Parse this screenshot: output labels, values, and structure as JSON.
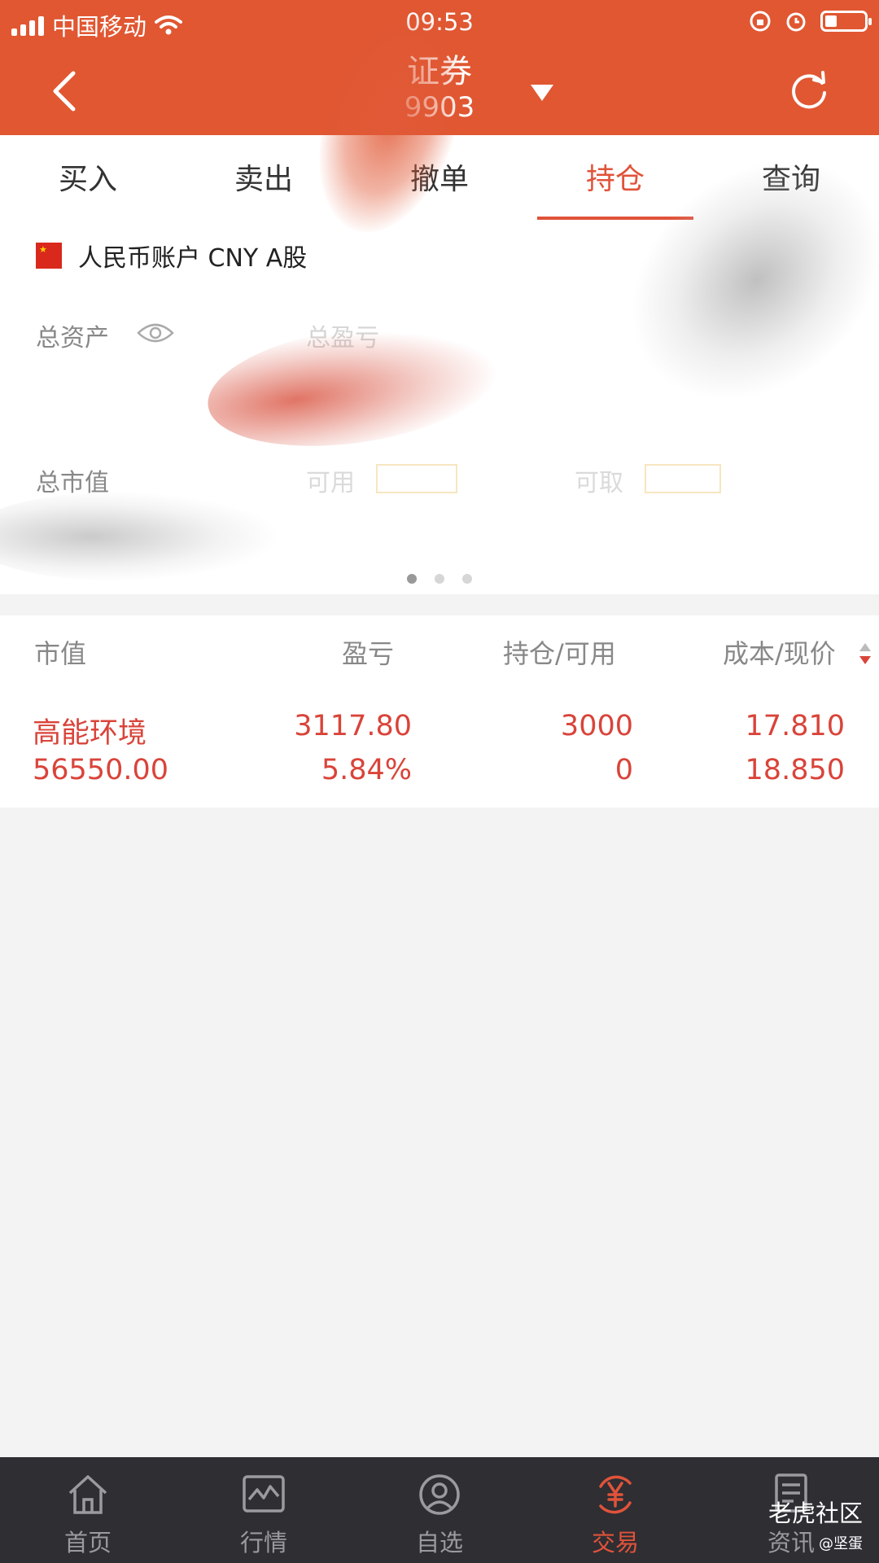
{
  "status_bar": {
    "carrier": "中国移动",
    "time": "09:53"
  },
  "nav": {
    "title": "证券",
    "subtitle": "9903"
  },
  "tabs": [
    {
      "label": "买入"
    },
    {
      "label": "卖出"
    },
    {
      "label": "撤单"
    },
    {
      "label": "持仓",
      "active": true
    },
    {
      "label": "查询"
    }
  ],
  "account": {
    "title": "人民币账户 CNY A股",
    "total_assets_label": "总资产",
    "total_pnl_label": "总盈亏",
    "market_value_label": "总市值",
    "available_label": "可用",
    "withdrawable_label": "可取"
  },
  "holdings": {
    "headers": {
      "market_value": "市值",
      "pnl": "盈亏",
      "position": "持仓/可用",
      "cost_price": "成本/现价"
    },
    "rows": [
      {
        "name": "高能环境",
        "market_value": "56550.00",
        "pnl": "3117.80",
        "pnl_pct": "5.84%",
        "position": "3000",
        "available": "0",
        "cost": "17.810",
        "price": "18.850"
      }
    ]
  },
  "bottom_nav": [
    {
      "label": "首页",
      "icon": "home-icon"
    },
    {
      "label": "行情",
      "icon": "chart-icon"
    },
    {
      "label": "自选",
      "icon": "watchlist-icon"
    },
    {
      "label": "交易",
      "icon": "trade-yen-icon",
      "active": true
    },
    {
      "label": "资讯",
      "icon": "news-icon"
    }
  ],
  "watermark": {
    "brand": "老虎社区",
    "user": "@坚蛋"
  },
  "colors": {
    "header": "#e05732",
    "accent": "#e0533a",
    "profit": "#d9443a",
    "bottom_bar": "#2e2e33"
  }
}
